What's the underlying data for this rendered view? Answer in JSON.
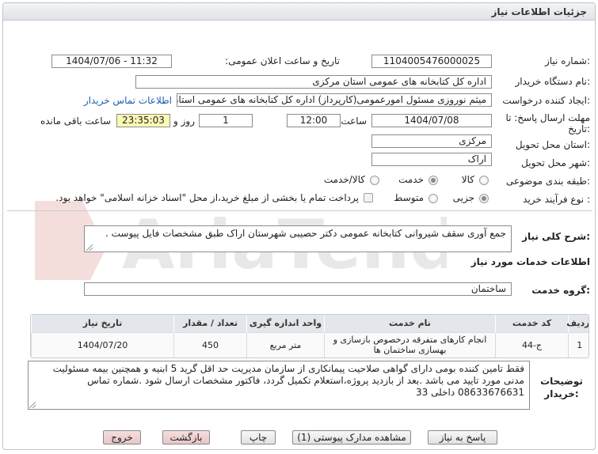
{
  "header": {
    "title": "جزئیات اطلاعات نیاز"
  },
  "fields": {
    "need_number_label": "شماره نیاز:",
    "need_number": "1104005476000025",
    "announce_label": "تاریخ و ساعت اعلان عمومی:",
    "announce_value": "1404/07/06 - 11:32",
    "buyer_label": "نام دستگاه خریدار:",
    "buyer_value": "اداره کل کتابخانه های عمومی استان مرکزی",
    "creator_label": "ایجاد کننده درخواست:",
    "creator_value": "میثم نوروزی مسئول امورعمومی(کارپرداز) اداره کل کتابخانه های عمومی استان",
    "contact_link": "اطلاعات تماس خریدار",
    "deadline_label_1": "مهلت ارسال پاسخ: تا",
    "deadline_label_2": "تاریخ:",
    "deadline_date": "1404/07/08",
    "time_label": "ساعت",
    "deadline_time": "12:00",
    "days_value": "1",
    "days_label": "روز و",
    "remaining_time": "23:35:03",
    "remaining_label": "ساعت باقی مانده",
    "province_label": "استان محل تحویل:",
    "province_value": "مرکزی",
    "city_label": "شهر محل تحویل:",
    "city_value": "اراک",
    "category_label": "طبقه بندی موضوعی:",
    "category_options": [
      "کالا",
      "خدمت",
      "کالا/خدمت"
    ],
    "process_label": "نوع فرآیند خرید :",
    "process_options": [
      "جزیی",
      "متوسط"
    ],
    "payment_note": "پرداخت تمام یا بخشی از مبلغ خرید،از محل \"اسناد خزانه اسلامی\" خواهد بود."
  },
  "description": {
    "label": "شرح کلی نیاز:",
    "value": "جمع آوری سقف شیروانی کتابخانه عمومی دکتر حصیبی شهرستان اراک طبق مشخصات فایل پیوست ."
  },
  "services": {
    "section_title": "اطلاعات خدمات مورد نیاز",
    "group_label": "گروه خدمت:",
    "group_value": "ساختمان",
    "columns": [
      "ردیف",
      "کد خدمت",
      "نام خدمت",
      "واحد اندازه گیری",
      "تعداد / مقدار",
      "تاریخ نیاز"
    ],
    "rows": [
      {
        "row": "1",
        "code": "ج-44",
        "name": "انجام کارهای متفرقه درخصوص بازسازی و بهسازی ساختمان ها",
        "unit": "متر مربع",
        "qty": "450",
        "date": "1404/07/20"
      }
    ]
  },
  "buyer_notes": {
    "label": "توضیحات خریدار:",
    "value": "فقط تامین کننده  بومی دارای گواهی صلاحیت پیمانکاری از سازمان مدیریت حد اقل گرید 5 ابنیه و همچنین بیمه مسئولیت مدنی مورد تایید می باشد .بعد از بازدید پروژه،استعلام تکمیل گردد، فاکتور مشخصات ارسال شود .شماره تماس 08633676631 داخلی 33"
  },
  "buttons": {
    "reply": "پاسخ به نیاز",
    "attachments": "مشاهده مدارک پیوستی (1)",
    "print": "چاپ",
    "back": "بازگشت",
    "exit": "خروج"
  },
  "watermark": {
    "text": "AriaTender.net"
  }
}
